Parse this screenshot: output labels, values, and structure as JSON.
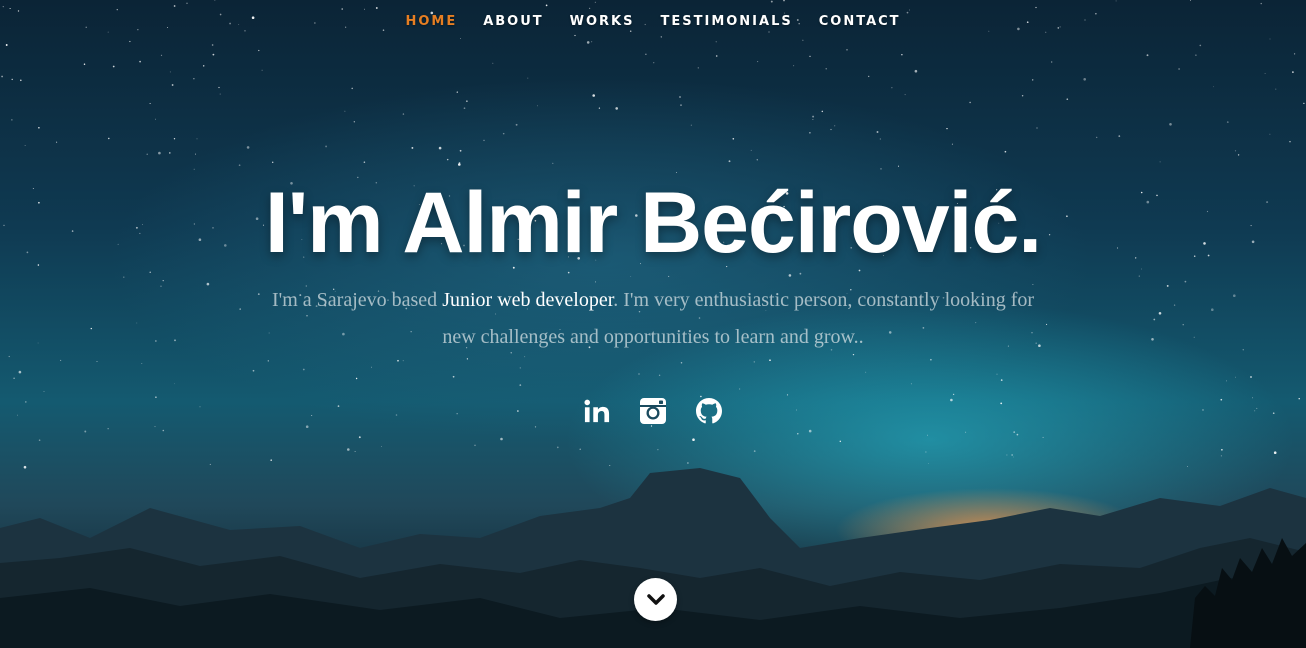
{
  "nav": {
    "items": [
      {
        "label": "HOME",
        "active": true
      },
      {
        "label": "ABOUT",
        "active": false
      },
      {
        "label": "WORKS",
        "active": false
      },
      {
        "label": "TESTIMONIALS",
        "active": false
      },
      {
        "label": "CONTACT",
        "active": false
      }
    ],
    "active_color": "#e67e22",
    "text_color": "#ffffff"
  },
  "hero": {
    "headline": "I'm Almir Bećirović.",
    "intro": {
      "before": "I'm a Sarajevo based ",
      "highlight": "Junior web developer",
      "after": ". I'm very enthusiastic person, constantly looking for new challenges and opportunities to learn and grow.."
    }
  },
  "social": [
    {
      "icon": "linkedin-icon"
    },
    {
      "icon": "instagram-icon"
    },
    {
      "icon": "github-icon"
    }
  ],
  "scroll_button": {
    "icon": "chevron-down-icon"
  }
}
